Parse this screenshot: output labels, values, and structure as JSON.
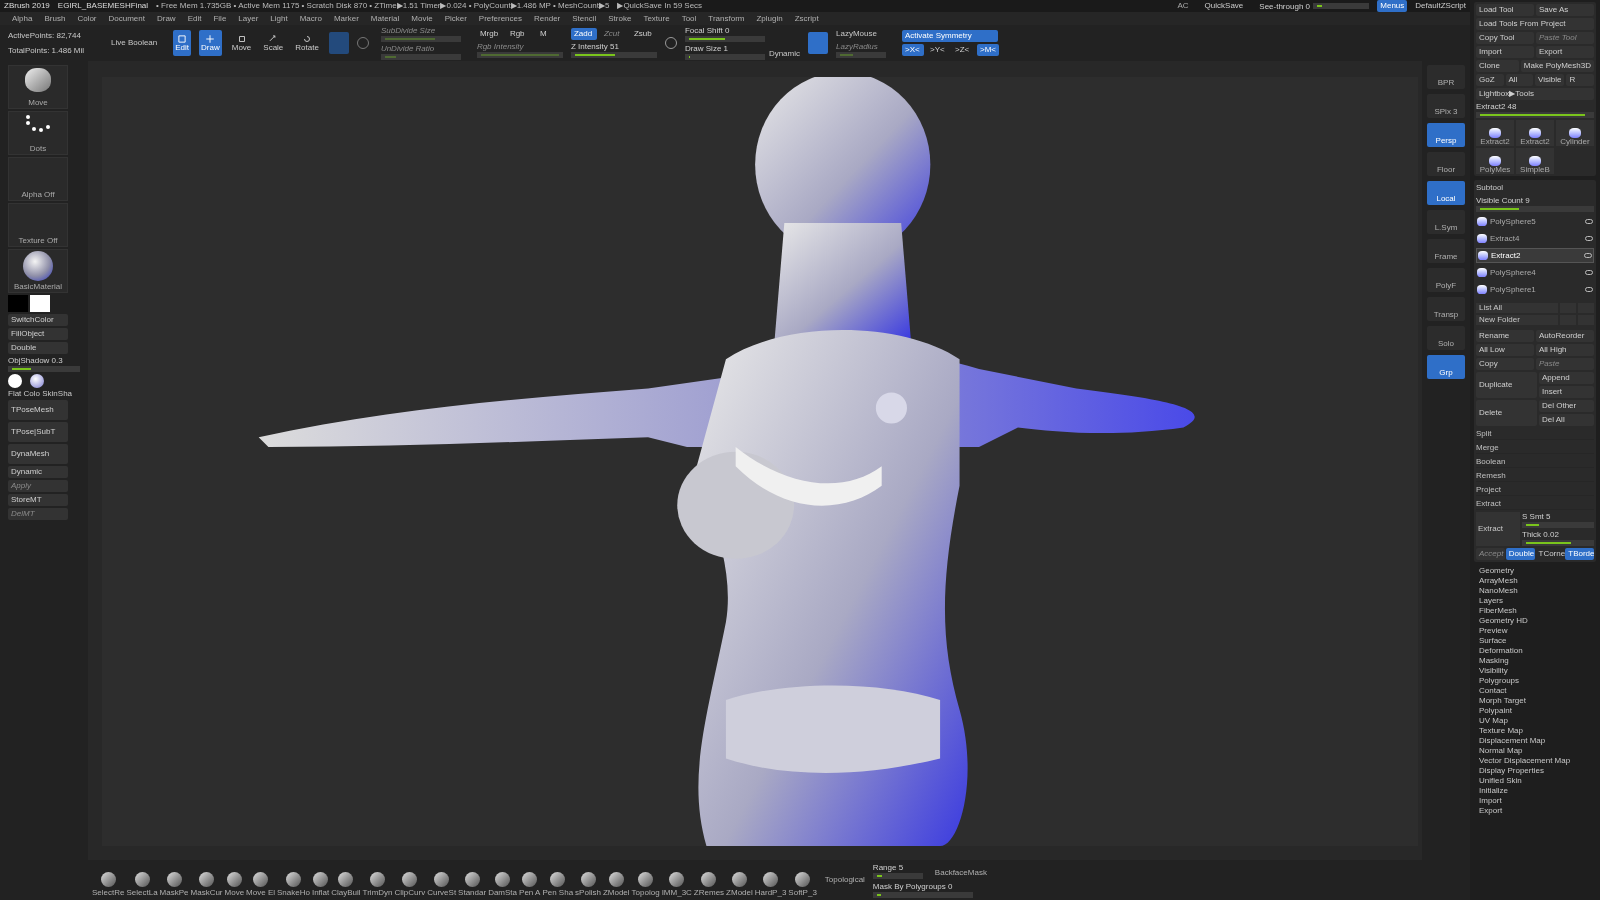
{
  "title_bar": {
    "app": "ZBrush 2019",
    "file": "EGIRL_BASEMESHFinal",
    "stats": "• Free Mem 1.735GB • Active Mem 1175 • Scratch Disk 870 • ZTime▶1.51 Timer▶0.024 • PolyCount▶1.486 MP • MeshCount▶5",
    "quicksave_timer": "▶QuickSave In 59 Secs",
    "ac": "AC",
    "quicksave": "QuickSave",
    "see_through": {
      "label": "See-through  0",
      "level": 0.1
    },
    "menus": {
      "label": "Menus",
      "selected": true
    },
    "script": "DefaultZScript"
  },
  "menu_bar": [
    "Alpha",
    "Brush",
    "Color",
    "Document",
    "Draw",
    "Edit",
    "File",
    "Layer",
    "Light",
    "Macro",
    "Marker",
    "Material",
    "Movie",
    "Picker",
    "Preferences",
    "Render",
    "Stencil",
    "Stroke",
    "Texture",
    "Tool",
    "Transform",
    "Zplugin",
    "Zscript"
  ],
  "toolbar": {
    "active_points": "ActivePoints: 82,744",
    "total_points": "TotalPoints: 1.486 Mil",
    "live_boolean": "Live Boolean",
    "modes": [
      {
        "label": "Edit",
        "selected": true
      },
      {
        "label": "Draw",
        "selected": true
      },
      {
        "label": "Move",
        "selected": false
      },
      {
        "label": "Scale",
        "selected": false
      },
      {
        "label": "Rotate",
        "selected": false
      }
    ],
    "subdivide": [
      {
        "label": "SubDivide Size",
        "level": 0.7,
        "disabled": true
      },
      {
        "label": "UnDivide Ratio",
        "level": 0.15,
        "disabled": true
      }
    ],
    "color_modes": [
      {
        "label": "Mrgb",
        "selected": false
      },
      {
        "label": "Rgb",
        "selected": false
      },
      {
        "label": "M",
        "selected": false
      }
    ],
    "rgb_intensity": {
      "label": "Rgb Intensity",
      "level": 1.0,
      "disabled": true
    },
    "z_modes": [
      {
        "label": "Zadd",
        "selected": true,
        "disabled": false
      },
      {
        "label": "Zcut",
        "selected": false,
        "disabled": true
      },
      {
        "label": "Zsub",
        "selected": false,
        "disabled": false
      }
    ],
    "z_intensity": {
      "label": "Z Intensity 51",
      "level": 0.51,
      "disabled": false
    },
    "focal_shift": {
      "label": "Focal Shift 0",
      "level": 0.5
    },
    "draw_size": {
      "label": "Draw Size 1",
      "level": 0.02
    },
    "dynamic": "Dynamic",
    "lazymouse": {
      "label": "LazyMouse",
      "selected": true
    },
    "lazyradius": {
      "label": "LazyRadius",
      "level": 0.3,
      "disabled": true
    },
    "symmetry": {
      "label": "Activate Symmetry",
      "selected": true
    },
    "axes": [
      {
        "label": ">X<",
        "selected": true
      },
      {
        "label": ">Y<",
        "selected": false
      },
      {
        "label": ">Z<",
        "selected": false
      },
      {
        "label": ">M<",
        "selected": true
      }
    ]
  },
  "left_shelf": {
    "tiles": [
      {
        "label": "Move",
        "kind": "brush"
      },
      {
        "label": "Dots",
        "kind": "stroke"
      },
      {
        "label": "Alpha Off",
        "kind": "empty"
      },
      {
        "label": "Texture Off",
        "kind": "empty"
      },
      {
        "label": "BasicMaterial",
        "kind": "material"
      }
    ],
    "buttons": [
      {
        "label": "SwitchColor",
        "disabled": false
      },
      {
        "label": "FillObject",
        "disabled": false
      },
      {
        "label": "Double",
        "disabled": false
      }
    ],
    "obj_shadow": {
      "label": "ObjShadow 0.3",
      "level": 0.3
    },
    "materials": "Flat Colo SkinSha",
    "actions": [
      {
        "label": "TPoseMesh",
        "disabled": false
      },
      {
        "label": "TPose|SubT",
        "disabled": false
      },
      {
        "label": "DynaMesh",
        "disabled": false
      },
      {
        "label": "Dynamic",
        "disabled": false
      },
      {
        "label": "Apply",
        "disabled": true
      },
      {
        "label": "StoreMT",
        "disabled": false
      },
      {
        "label": "DelMT",
        "disabled": true
      }
    ]
  },
  "right_dock": {
    "buttons": [
      {
        "label": "BPR",
        "selected": false
      },
      {
        "label": "SPix 3",
        "selected": false
      },
      {
        "label": "Persp",
        "selected": true
      },
      {
        "label": "Floor",
        "selected": false
      },
      {
        "label": "Local",
        "selected": true
      },
      {
        "label": "L.Sym",
        "selected": false
      },
      {
        "label": "Frame",
        "selected": false
      },
      {
        "label": "PolyF",
        "selected": false
      },
      {
        "label": "Transp",
        "selected": false
      },
      {
        "label": "Solo",
        "selected": false
      },
      {
        "label": "Grp",
        "selected": true
      }
    ]
  },
  "tool_panel": {
    "rows": [
      [
        {
          "label": "Load Tool",
          "disabled": false
        },
        {
          "label": "Save As",
          "disabled": false
        }
      ],
      [
        {
          "label": "Load Tools From Project",
          "disabled": false
        }
      ],
      [
        {
          "label": "Copy Tool",
          "disabled": false
        },
        {
          "label": "Paste Tool",
          "disabled": true
        }
      ],
      [
        {
          "label": "Import",
          "disabled": false
        },
        {
          "label": "Export",
          "disabled": false
        }
      ],
      [
        {
          "label": "Clone",
          "disabled": false
        },
        {
          "label": "Make PolyMesh3D",
          "disabled": false
        }
      ],
      [
        {
          "label": "GoZ",
          "disabled": false
        },
        {
          "label": "All",
          "disabled": false
        },
        {
          "label": "Visible",
          "disabled": false
        },
        {
          "label": "R",
          "disabled": false
        }
      ],
      [
        {
          "label": "Lightbox▶Tools",
          "disabled": false
        }
      ]
    ],
    "current_tool": {
      "label": "Extract2  48",
      "level": 0.95
    },
    "thumbnails": [
      {
        "label": "Extract2"
      },
      {
        "label": "Extract2"
      },
      {
        "label": "Cylinder"
      },
      {
        "label": "PolyMes"
      },
      {
        "label": "SimpleB"
      }
    ]
  },
  "subtool": {
    "title": "Subtool",
    "visible_count": {
      "label": "Visible Count 9",
      "level": 0.35
    },
    "items": [
      {
        "name": "PolySphere5",
        "selected": false
      },
      {
        "name": "Extract4",
        "selected": false
      },
      {
        "name": "Extract2",
        "selected": true
      },
      {
        "name": "PolySphere4",
        "selected": false
      },
      {
        "name": "PolySphere1",
        "selected": false
      }
    ],
    "list_all": "List All",
    "new_folder": "New Folder",
    "grid": [
      [
        {
          "label": "Rename",
          "disabled": false
        },
        {
          "label": "AutoReorder",
          "disabled": false
        }
      ],
      [
        {
          "label": "All Low",
          "disabled": false
        },
        {
          "label": "All High",
          "disabled": false
        }
      ],
      [
        {
          "label": "Copy",
          "disabled": false
        },
        {
          "label": "Paste",
          "disabled": true
        }
      ],
      [
        {
          "label": "Duplicate",
          "disabled": false
        },
        {
          "label": "Append",
          "disabled": false
        },
        {
          "label": "Insert",
          "disabled": false
        }
      ],
      [
        {
          "label": "Delete",
          "disabled": false
        },
        {
          "label": "Del Other",
          "disabled": false
        },
        {
          "label": "Del All",
          "disabled": false
        }
      ]
    ],
    "sections": [
      "Split",
      "Merge",
      "Boolean",
      "Remesh",
      "Project",
      "Extract"
    ],
    "extract": {
      "label": "Extract",
      "smooth": {
        "label": "S Smt 5",
        "level": 0.2
      },
      "thick": {
        "label": "Thick 0.02",
        "level": 0.7
      }
    },
    "extract_options": [
      {
        "label": "Accept",
        "selected": false,
        "disabled": true
      },
      {
        "label": "Double",
        "selected": true,
        "disabled": false
      },
      {
        "label": "TCorne",
        "selected": false,
        "disabled": false
      },
      {
        "label": "TBorde",
        "selected": true,
        "disabled": false
      }
    ]
  },
  "tool_menus": [
    "Geometry",
    "ArrayMesh",
    "NanoMesh",
    "Layers",
    "FiberMesh",
    "Geometry HD",
    "Preview",
    "Surface",
    "Deformation",
    "Masking",
    "Visibility",
    "Polygroups",
    "Contact",
    "Morph Target",
    "Polypaint",
    "UV Map",
    "Texture Map",
    "Displacement Map",
    "Normal Map",
    "Vector Displacement Map",
    "Display Properties",
    "Unified Skin",
    "Initialize",
    "Import",
    "Export"
  ],
  "bottom_bar": {
    "brushes": [
      "SelectRe",
      "SelectLa",
      "MaskPe",
      "MaskCur",
      "Move",
      "Move El",
      "SnakeHo",
      "Inflat",
      "ClayBuil",
      "TrimDyn",
      "ClipCurv",
      "CurveSt",
      "Standar",
      "DamSta",
      "Pen A",
      "Pen Sha",
      "sPolish",
      "ZModel",
      "Topolog",
      "IMM_3C",
      "ZRemes",
      "ZModel",
      "HardP_3",
      "SoftP_3"
    ],
    "topological": "Topological",
    "range": {
      "label": "Range 5",
      "level": 0.12
    },
    "backface": "BackfaceMask",
    "mask_polygroups": {
      "label": "Mask By Polygroups 0",
      "level": 0.05
    }
  }
}
